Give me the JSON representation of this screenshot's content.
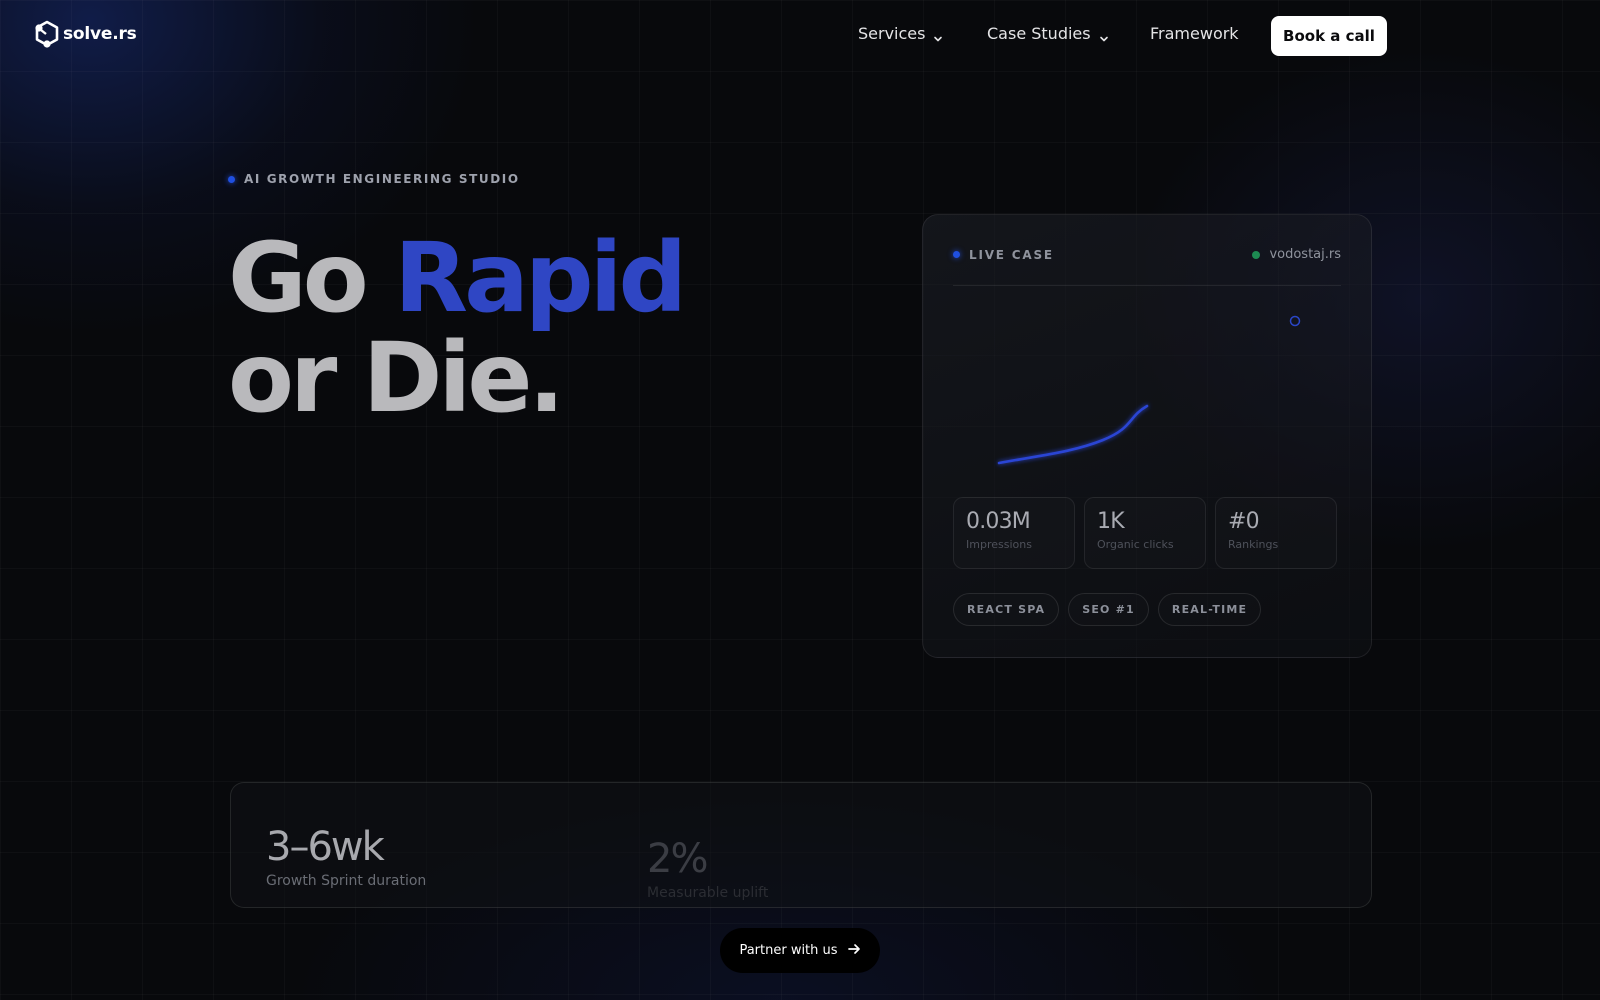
{
  "brand": {
    "name": "solve.rs",
    "icon": "hexagon-node-logo-icon"
  },
  "nav": {
    "items": [
      {
        "label": "Services",
        "has_dropdown": true
      },
      {
        "label": "Case Studies",
        "has_dropdown": true
      },
      {
        "label": "Framework",
        "has_dropdown": false
      }
    ],
    "cta_label": "Book a call"
  },
  "hero": {
    "eyebrow": "AI GROWTH ENGINEERING STUDIO",
    "headline_part1": "Go ",
    "headline_accent": "Rapid",
    "headline_line2": "or Die."
  },
  "live_case": {
    "tag": "LIVE CASE",
    "site": "vodostaj.rs",
    "metrics": [
      {
        "value": "0.03M",
        "label": "Impressions"
      },
      {
        "value": "1K",
        "label": "Organic clicks"
      },
      {
        "value": "#0",
        "label": "Rankings"
      }
    ],
    "chips": [
      "REACT SPA",
      "SEO #1",
      "REAL-TIME"
    ]
  },
  "stats": [
    {
      "value": "3–6wk",
      "label": "Growth Sprint duration"
    },
    {
      "value": "2%",
      "label": "Measurable uplift"
    }
  ],
  "partner_cta": "Partner with us",
  "colors": {
    "accent_blue": "#2f46c4",
    "live_dot_blue": "#1f4fe0",
    "status_green": "#1d8a52",
    "background": "#08090c"
  }
}
